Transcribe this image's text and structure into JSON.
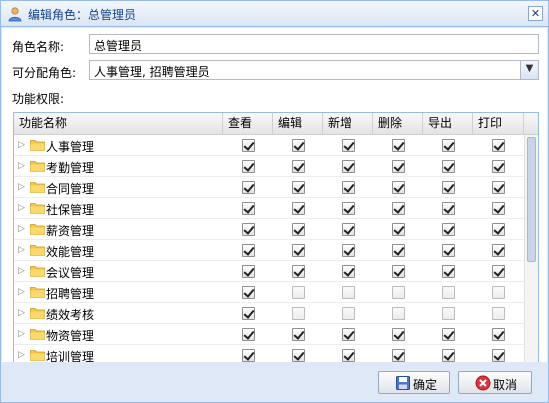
{
  "dialog": {
    "title": "编辑角色：总管理员"
  },
  "form": {
    "role_name_label": "角色名称:",
    "role_name_value": "总管理员",
    "assignable_label": "可分配角色:",
    "assignable_value": "人事管理, 招聘管理员",
    "permissions_label": "功能权限:"
  },
  "grid": {
    "columns": [
      "功能名称",
      "查看",
      "编辑",
      "新增",
      "删除",
      "导出",
      "打印"
    ],
    "rows": [
      {
        "name": "人事管理",
        "perms": [
          true,
          true,
          true,
          true,
          true,
          true
        ]
      },
      {
        "name": "考勤管理",
        "perms": [
          true,
          true,
          true,
          true,
          true,
          true
        ]
      },
      {
        "name": "合同管理",
        "perms": [
          true,
          true,
          true,
          true,
          true,
          true
        ]
      },
      {
        "name": "社保管理",
        "perms": [
          true,
          true,
          true,
          true,
          true,
          true
        ]
      },
      {
        "name": "薪资管理",
        "perms": [
          true,
          true,
          true,
          true,
          true,
          true
        ]
      },
      {
        "name": "效能管理",
        "perms": [
          true,
          true,
          true,
          true,
          true,
          true
        ]
      },
      {
        "name": "会议管理",
        "perms": [
          true,
          true,
          true,
          true,
          true,
          true
        ]
      },
      {
        "name": "招聘管理",
        "perms": [
          true,
          false,
          false,
          false,
          false,
          false
        ]
      },
      {
        "name": "绩效考核",
        "perms": [
          true,
          false,
          false,
          false,
          false,
          false
        ]
      },
      {
        "name": "物资管理",
        "perms": [
          true,
          true,
          true,
          true,
          true,
          true
        ]
      },
      {
        "name": "培训管理",
        "perms": [
          true,
          true,
          true,
          true,
          true,
          true
        ]
      }
    ]
  },
  "buttons": {
    "ok": "确定",
    "cancel": "取消"
  },
  "colors": {
    "title": "#15428b",
    "border": "#99bbe8",
    "folder": "#f5c84c"
  },
  "icons": {
    "title": "user-icon",
    "close": "close-icon",
    "ok": "save-icon",
    "cancel": "cancel-icon",
    "row": "folder-icon"
  }
}
